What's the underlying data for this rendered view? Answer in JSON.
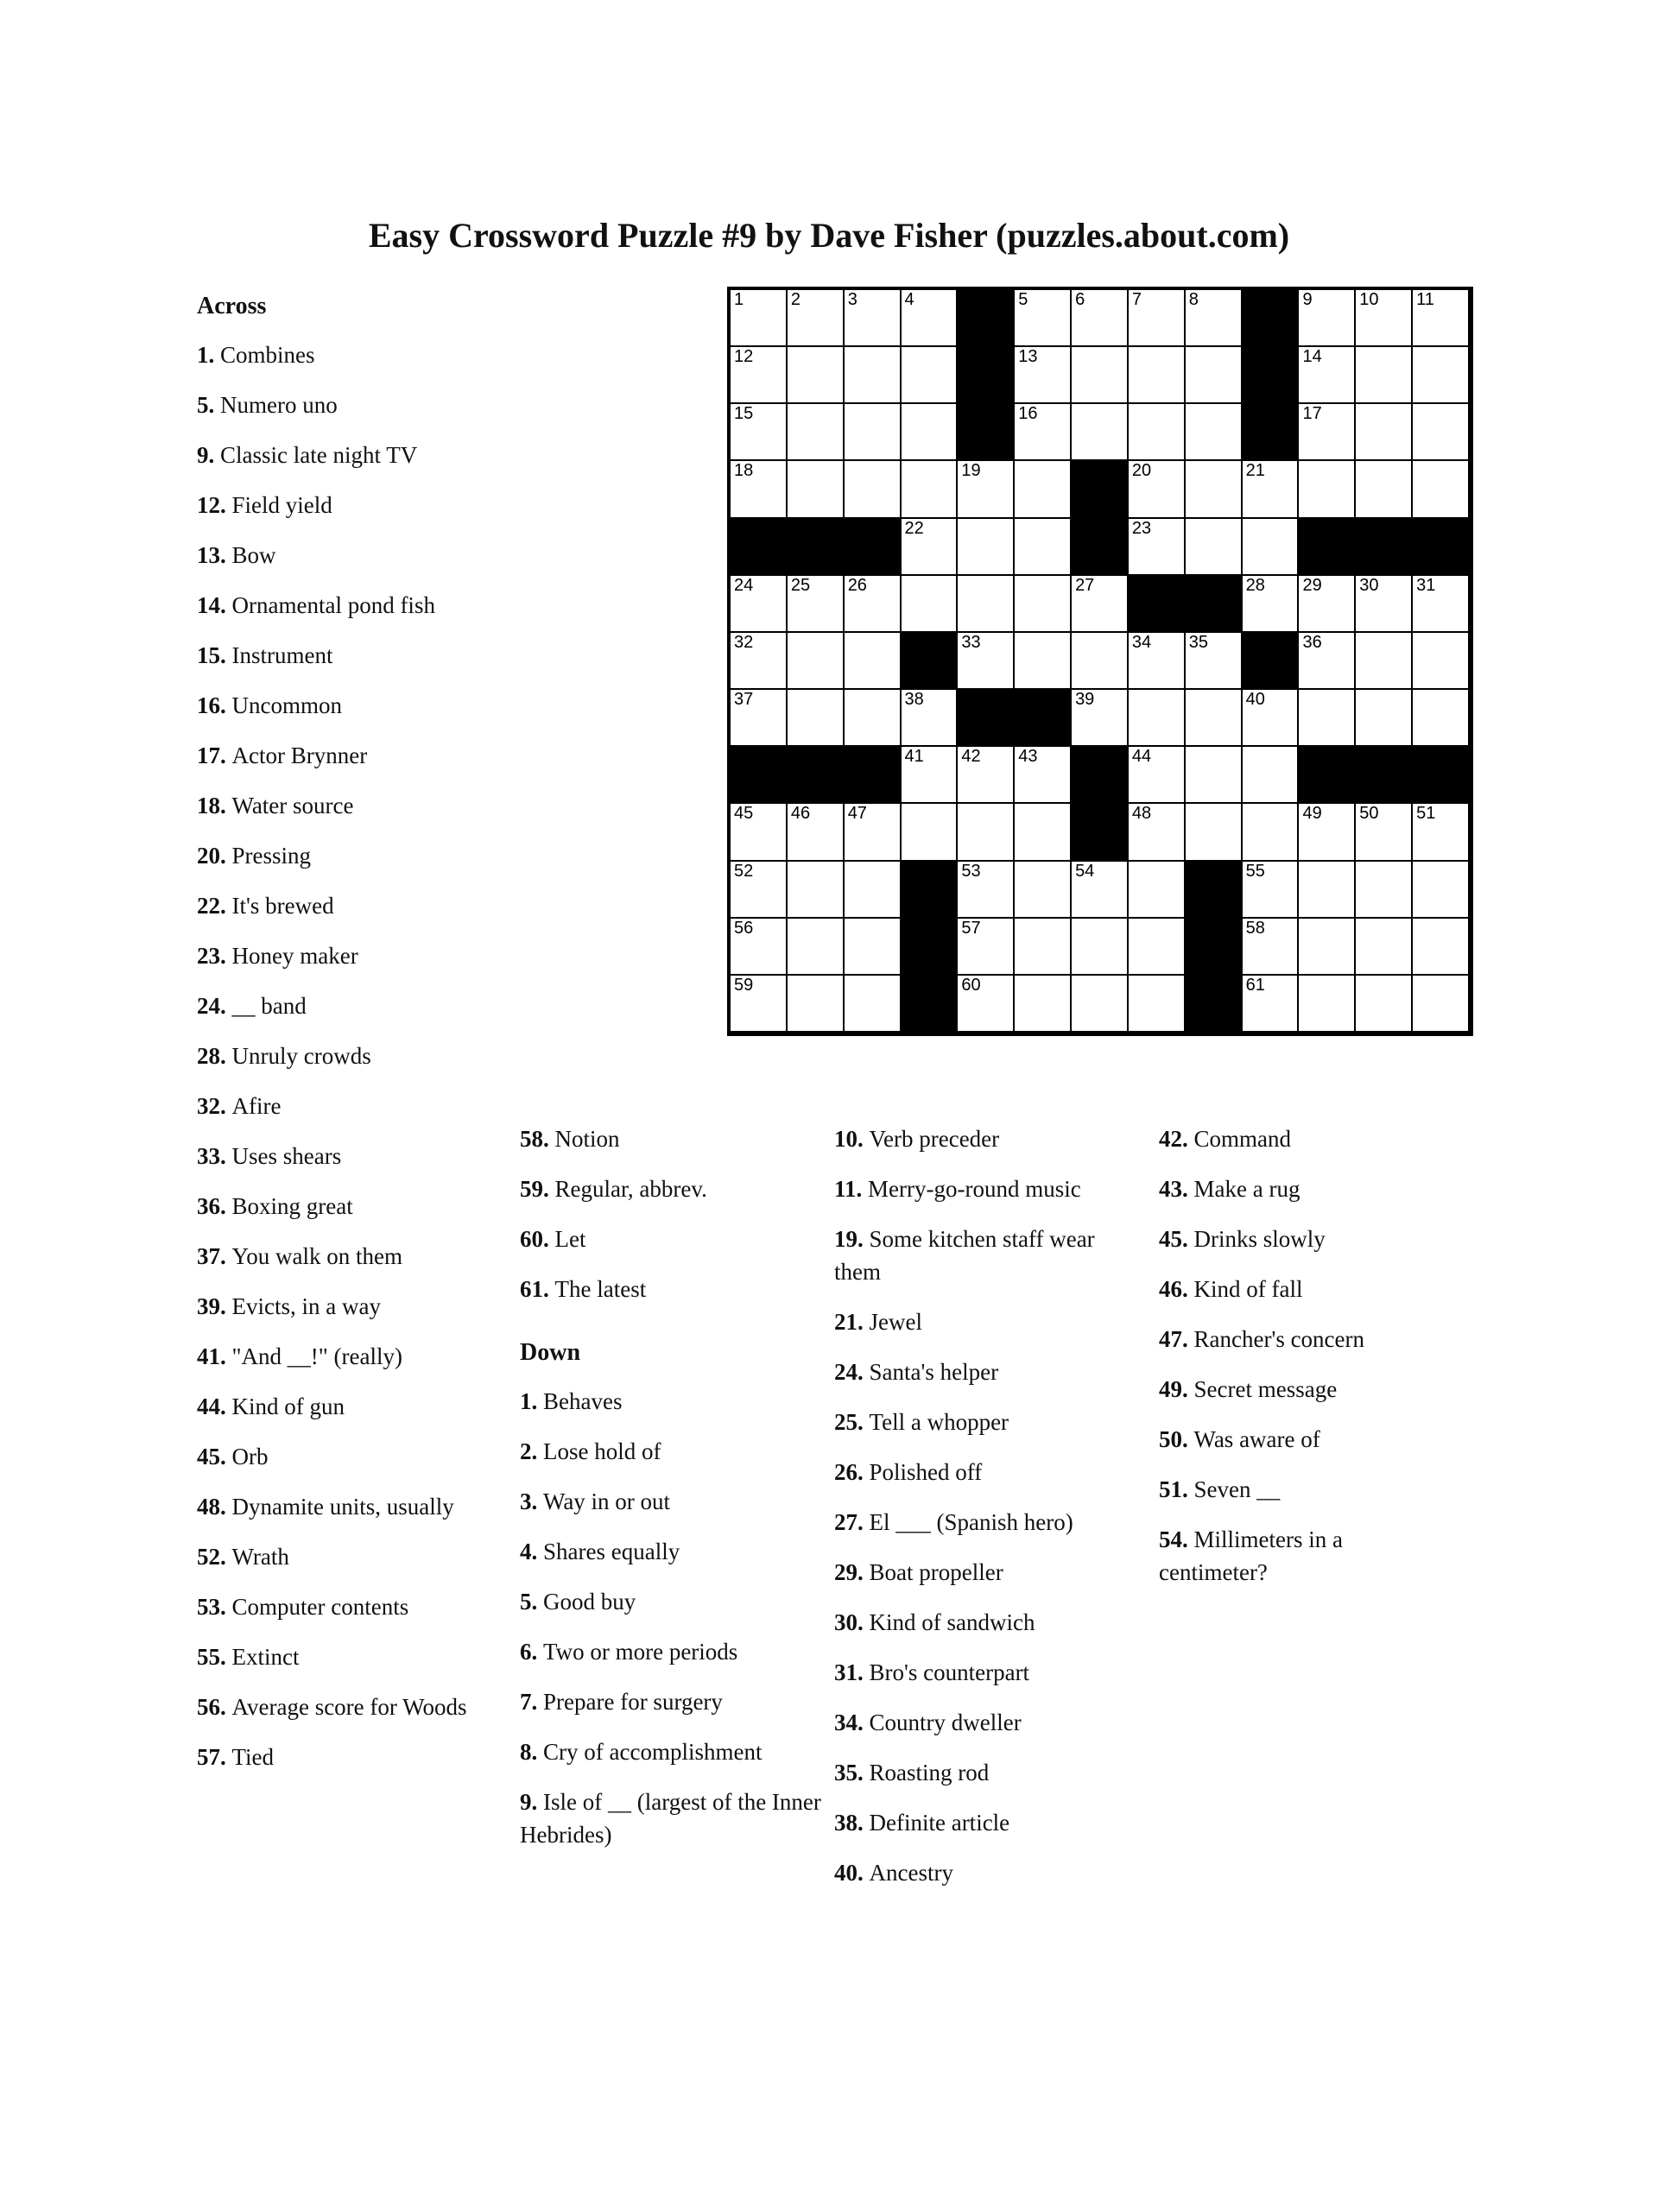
{
  "title": "Easy Crossword Puzzle #9 by Dave Fisher (puzzles.about.com)",
  "headings": {
    "across": "Across",
    "down": "Down"
  },
  "grid": {
    "rows": 13,
    "cols": 13,
    "block_color": "#000000",
    "cell_color": "#ffffff",
    "layout": [
      [
        "1",
        "2",
        "3",
        "4",
        "#",
        "5",
        "6",
        "7",
        "8",
        "#",
        "9",
        "10",
        "11"
      ],
      [
        "12",
        "",
        "",
        "",
        "#",
        "13",
        "",
        "",
        "",
        "#",
        "14",
        "",
        ""
      ],
      [
        "15",
        "",
        "",
        "",
        "#",
        "16",
        "",
        "",
        "",
        "#",
        "17",
        "",
        ""
      ],
      [
        "18",
        "",
        "",
        "",
        "19",
        "",
        "#",
        "20",
        "",
        "21",
        "",
        "",
        ""
      ],
      [
        "#",
        "#",
        "#",
        "22",
        "",
        "",
        "#",
        "23",
        "",
        "",
        "#",
        "#",
        "#"
      ],
      [
        "24",
        "25",
        "26",
        "",
        "",
        "",
        "27",
        "#",
        "#",
        "28",
        "29",
        "30",
        "31"
      ],
      [
        "32",
        "",
        "",
        "#",
        "33",
        "",
        "",
        "34",
        "35",
        "#",
        "36",
        "",
        ""
      ],
      [
        "37",
        "",
        "",
        "38",
        "#",
        "#",
        "39",
        "",
        "",
        "40",
        "",
        "",
        ""
      ],
      [
        "#",
        "#",
        "#",
        "41",
        "42",
        "43",
        "#",
        "44",
        "",
        "",
        "#",
        "#",
        "#"
      ],
      [
        "45",
        "46",
        "47",
        "",
        "",
        "",
        "#",
        "48",
        "",
        "",
        "49",
        "50",
        "51"
      ],
      [
        "52",
        "",
        "",
        "#",
        "53",
        "",
        "54",
        "",
        "#",
        "55",
        "",
        "",
        ""
      ],
      [
        "56",
        "",
        "",
        "#",
        "57",
        "",
        "",
        "",
        "#",
        "58",
        "",
        "",
        ""
      ],
      [
        "59",
        "",
        "",
        "#",
        "60",
        "",
        "",
        "",
        "#",
        "61",
        "",
        "",
        ""
      ]
    ]
  },
  "across": [
    {
      "n": "1.",
      "t": "Combines"
    },
    {
      "n": "5.",
      "t": "Numero uno"
    },
    {
      "n": "9.",
      "t": "Classic late night TV"
    },
    {
      "n": "12.",
      "t": "Field yield"
    },
    {
      "n": "13.",
      "t": "Bow"
    },
    {
      "n": "14.",
      "t": "Ornamental pond fish"
    },
    {
      "n": "15.",
      "t": "Instrument"
    },
    {
      "n": "16.",
      "t": "Uncommon"
    },
    {
      "n": "17.",
      "t": "Actor Brynner"
    },
    {
      "n": "18.",
      "t": "Water source"
    },
    {
      "n": "20.",
      "t": "Pressing"
    },
    {
      "n": "22.",
      "t": "It's brewed"
    },
    {
      "n": "23.",
      "t": "Honey maker"
    },
    {
      "n": "24.",
      "t": "__ band"
    },
    {
      "n": "28.",
      "t": "Unruly crowds"
    },
    {
      "n": "32.",
      "t": "Afire"
    },
    {
      "n": "33.",
      "t": "Uses shears"
    },
    {
      "n": "36.",
      "t": "Boxing great"
    },
    {
      "n": "37.",
      "t": "You walk on them"
    },
    {
      "n": "39.",
      "t": "Evicts, in a way"
    },
    {
      "n": "41.",
      "t": "\"And __!\" (really)"
    },
    {
      "n": "44.",
      "t": "Kind of gun"
    },
    {
      "n": "45.",
      "t": "Orb"
    },
    {
      "n": "48.",
      "t": "Dynamite units, usually"
    },
    {
      "n": "52.",
      "t": "Wrath"
    },
    {
      "n": "53.",
      "t": "Computer contents"
    },
    {
      "n": "55.",
      "t": "Extinct"
    },
    {
      "n": "56.",
      "t": "Average score for Woods"
    },
    {
      "n": "57.",
      "t": "Tied"
    },
    {
      "n": "58.",
      "t": "Notion"
    },
    {
      "n": "59.",
      "t": "Regular, abbrev."
    },
    {
      "n": "60.",
      "t": "Let"
    },
    {
      "n": "61.",
      "t": "The latest"
    }
  ],
  "down": [
    {
      "n": "1.",
      "t": "Behaves"
    },
    {
      "n": "2.",
      "t": "Lose hold of"
    },
    {
      "n": "3.",
      "t": "Way in or out"
    },
    {
      "n": "4.",
      "t": "Shares equally"
    },
    {
      "n": "5.",
      "t": "Good buy"
    },
    {
      "n": "6.",
      "t": "Two or more periods"
    },
    {
      "n": "7.",
      "t": "Prepare for surgery"
    },
    {
      "n": "8.",
      "t": "Cry of accomplishment"
    },
    {
      "n": "9.",
      "t": "Isle of __ (largest of the Inner Hebrides)"
    },
    {
      "n": "10.",
      "t": "Verb preceder"
    },
    {
      "n": "11.",
      "t": "Merry-go-round music"
    },
    {
      "n": "19.",
      "t": "Some kitchen staff wear them"
    },
    {
      "n": "21.",
      "t": "Jewel"
    },
    {
      "n": "24.",
      "t": "Santa's helper"
    },
    {
      "n": "25.",
      "t": "Tell a whopper"
    },
    {
      "n": "26.",
      "t": "Polished off"
    },
    {
      "n": "27.",
      "t": "El ___ (Spanish hero)"
    },
    {
      "n": "29.",
      "t": "Boat propeller"
    },
    {
      "n": "30.",
      "t": "Kind of sandwich"
    },
    {
      "n": "31.",
      "t": "Bro's counterpart"
    },
    {
      "n": "34.",
      "t": "Country dweller"
    },
    {
      "n": "35.",
      "t": "Roasting rod"
    },
    {
      "n": "38.",
      "t": "Definite article"
    },
    {
      "n": "40.",
      "t": "Ancestry"
    },
    {
      "n": "42.",
      "t": "Command"
    },
    {
      "n": "43.",
      "t": "Make a rug"
    },
    {
      "n": "45.",
      "t": "Drinks slowly"
    },
    {
      "n": "46.",
      "t": "Kind of fall"
    },
    {
      "n": "47.",
      "t": "Rancher's concern"
    },
    {
      "n": "49.",
      "t": "Secret message"
    },
    {
      "n": "50.",
      "t": "Was aware of"
    },
    {
      "n": "51.",
      "t": "Seven __"
    },
    {
      "n": "54.",
      "t": "Millimeters in a centimeter?"
    }
  ],
  "columns": {
    "col1_across_range": [
      0,
      29
    ],
    "col2_across_range": [
      29,
      33
    ],
    "col2_down_range": [
      0,
      9
    ],
    "col3_down_range": [
      9,
      24
    ],
    "col4_down_range": [
      24,
      33
    ]
  }
}
